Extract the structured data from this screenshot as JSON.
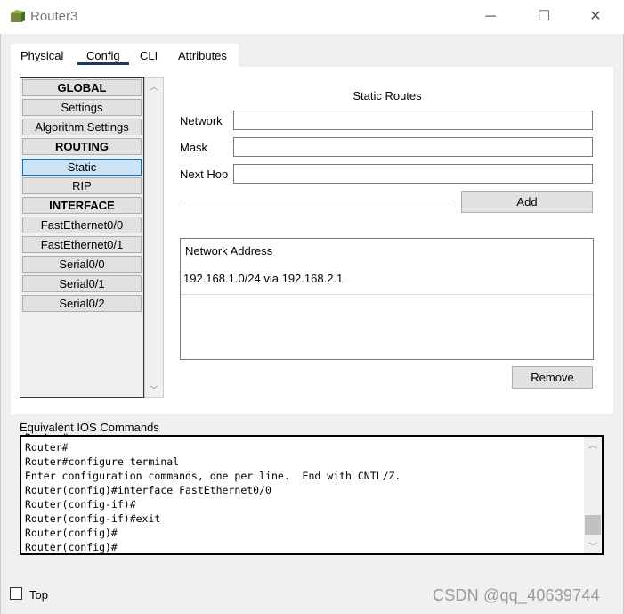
{
  "window": {
    "title": "Router3",
    "min_icon": "─",
    "max_icon": "☐",
    "close_icon": "✕"
  },
  "tabs": [
    {
      "label": "Physical"
    },
    {
      "label": "Config",
      "active": true
    },
    {
      "label": "CLI"
    },
    {
      "label": "Attributes"
    }
  ],
  "sidebar": {
    "items": [
      {
        "label": "GLOBAL",
        "type": "header"
      },
      {
        "label": "Settings"
      },
      {
        "label": "Algorithm Settings"
      },
      {
        "label": "ROUTING",
        "type": "header"
      },
      {
        "label": "Static",
        "selected": true
      },
      {
        "label": "RIP"
      },
      {
        "label": "INTERFACE",
        "type": "header"
      },
      {
        "label": "FastEthernet0/0"
      },
      {
        "label": "FastEthernet0/1"
      },
      {
        "label": "Serial0/0"
      },
      {
        "label": "Serial0/1"
      },
      {
        "label": "Serial0/2"
      }
    ]
  },
  "static_routes": {
    "title": "Static Routes",
    "network_label": "Network",
    "network_value": "",
    "mask_label": "Mask",
    "mask_value": "",
    "next_hop_label": "Next Hop",
    "next_hop_value": "",
    "add_label": "Add",
    "table_header": "Network Address",
    "routes": [
      "192.168.1.0/24 via 192.168.2.1"
    ],
    "remove_label": "Remove"
  },
  "ios": {
    "label": "Equivalent IOS Commands",
    "lines": [
      "Router#",
      "Router#configure terminal",
      "Enter configuration commands, one per line.  End with CNTL/Z.",
      "Router(config)#interface FastEthernet0/0",
      "Router(config-if)#",
      "Router(config-if)#exit",
      "Router(config)#",
      "Router(config)#"
    ]
  },
  "footer": {
    "top_label": "Top",
    "top_checked": false
  },
  "watermark": "CSDN @qq_40639744",
  "colors": {
    "selected_bg": "#cce4f7",
    "tab_underline": "#1b3a5c"
  }
}
